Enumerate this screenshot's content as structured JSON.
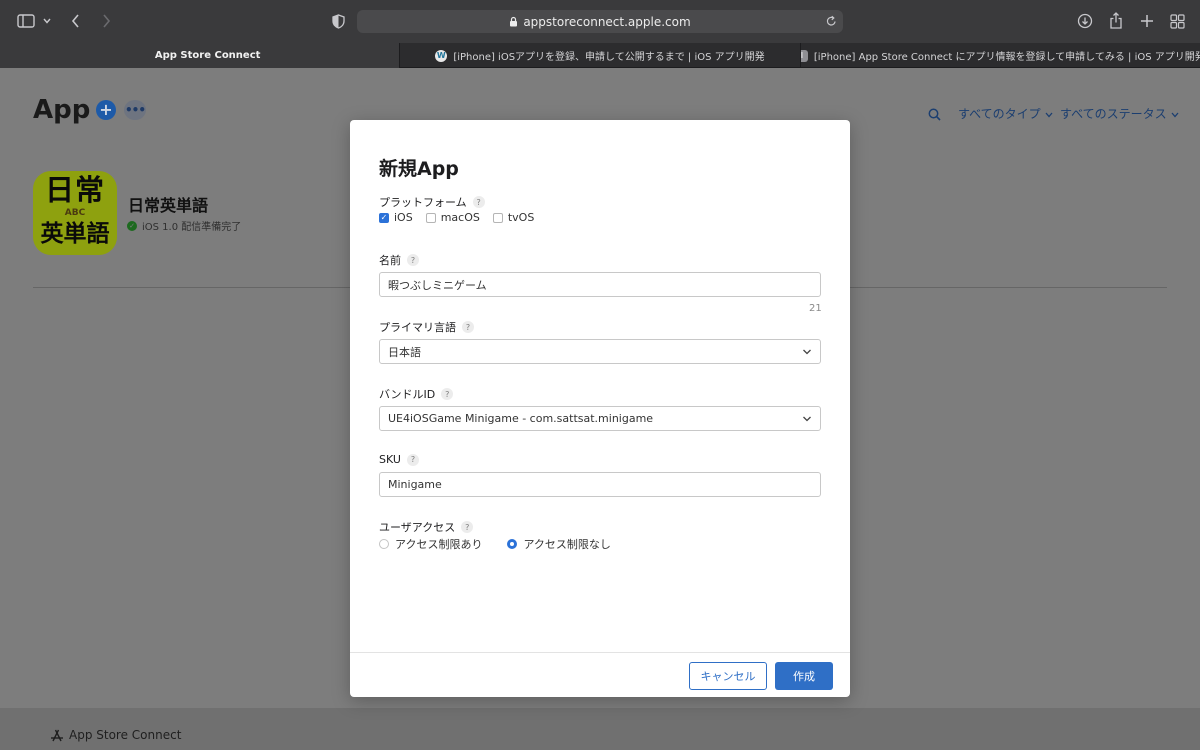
{
  "browser": {
    "url": "appstoreconnect.apple.com",
    "tabs": [
      {
        "label": "App Store Connect",
        "favicon": "apple-icon",
        "active": true
      },
      {
        "label": "[iPhone] iOSアプリを登録、申請して公開するまで | iOS アプリ開発",
        "favicon": "wordpress-icon",
        "active": false
      },
      {
        "label": "[iPhone] App Store Connect にアプリ情報を登録して申請してみる | iOS アプリ開発",
        "favicon": "page-icon",
        "favicon_text": "I",
        "active": false
      }
    ]
  },
  "page": {
    "title": "App",
    "add_icon": "+",
    "more_icon": "•••",
    "filters": {
      "type": "すべてのタイプ",
      "status": "すべてのステータス"
    },
    "app": {
      "name": "日常英単語",
      "status": "iOS 1.0 配信準備完了",
      "icon_text_top": "日常",
      "icon_text_mid": "ABC",
      "icon_text_bottom": "英単語"
    },
    "footer_brand": "App Store Connect"
  },
  "modal": {
    "title": "新規App",
    "help_glyph": "?",
    "platform": {
      "label": "プラットフォーム",
      "options": [
        {
          "label": "iOS",
          "checked": true
        },
        {
          "label": "macOS",
          "checked": false
        },
        {
          "label": "tvOS",
          "checked": false
        }
      ]
    },
    "name": {
      "label": "名前",
      "value": "暇つぶしミニゲーム",
      "remaining": "21"
    },
    "primary_language": {
      "label": "プライマリ言語",
      "value": "日本語"
    },
    "bundle_id": {
      "label": "バンドルID",
      "value": "UE4iOSGame Minigame - com.sattsat.minigame"
    },
    "sku": {
      "label": "SKU",
      "value": "Minigame"
    },
    "user_access": {
      "label": "ユーザアクセス",
      "options": [
        {
          "label": "アクセス制限あり",
          "selected": false
        },
        {
          "label": "アクセス制限なし",
          "selected": true
        }
      ]
    },
    "buttons": {
      "cancel": "キャンセル",
      "create": "作成"
    }
  },
  "colors": {
    "accent": "#2f6fc6",
    "app_icon_bg": "#8ea10f"
  }
}
